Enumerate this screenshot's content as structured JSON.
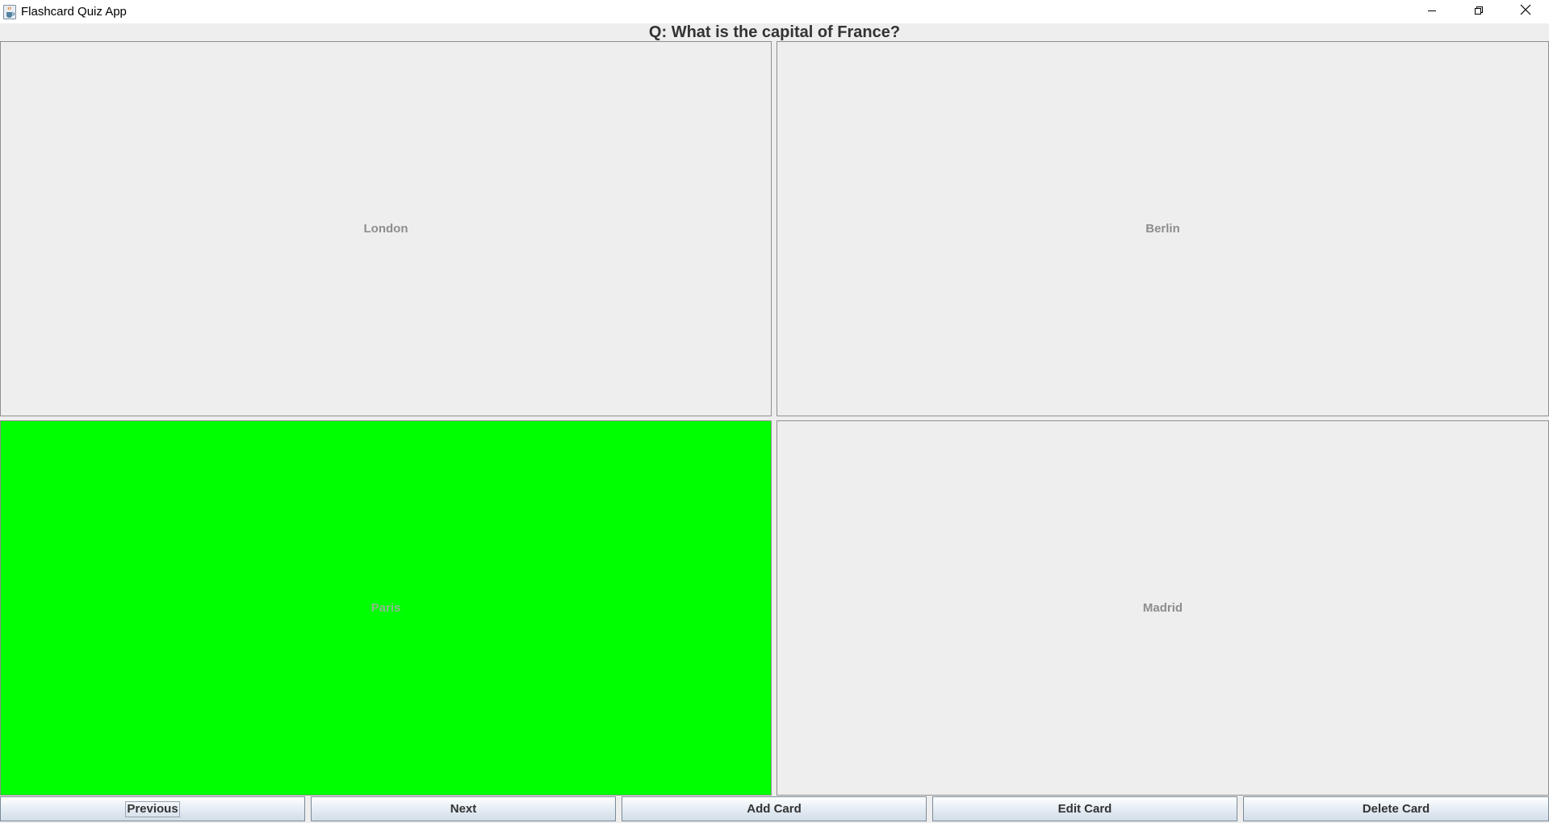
{
  "window": {
    "title": "Flashcard Quiz App",
    "icon": "java-cup-icon",
    "controls": [
      "minimize-icon",
      "restore-icon",
      "close-icon"
    ]
  },
  "card": {
    "question": "Q: What is the capital of France?",
    "answers": [
      {
        "label": "London",
        "state": "default"
      },
      {
        "label": "Berlin",
        "state": "default"
      },
      {
        "label": "Paris",
        "state": "correct"
      },
      {
        "label": "Madrid",
        "state": "default"
      }
    ]
  },
  "buttons": {
    "previous": "Previous",
    "next": "Next",
    "add": "Add Card",
    "edit": "Edit Card",
    "delete": "Delete Card"
  },
  "colors": {
    "correct": "#00ff00",
    "default_background": "#eeeeee",
    "answer_text": "#8d8d8d"
  }
}
